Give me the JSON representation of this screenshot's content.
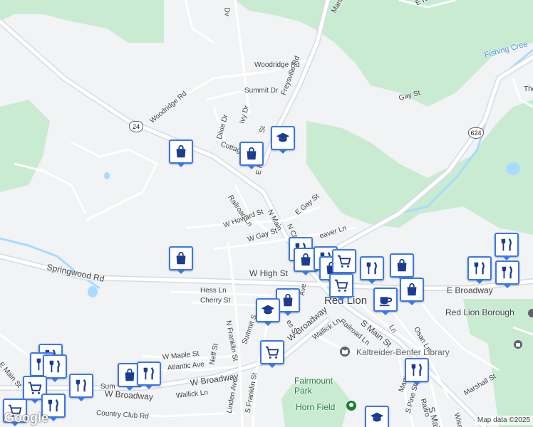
{
  "map": {
    "attribution": "Map data ©2025",
    "logo": "Google",
    "colors": {
      "land": "#f1f3f4",
      "park": "#c8ebd2",
      "water": "#aadaff",
      "major_road": "#d6dbe0",
      "road": "#ffffff",
      "pin": "#3b78e7",
      "pin_icon": "#1a3d8f"
    },
    "shields": {
      "route24": "24",
      "route624": "624"
    },
    "labels": {
      "manor": "Manor",
      "woodridge_rd_top": "Woodridge Rd",
      "freysville_rd": "Freysville Rd",
      "woodridge_rd": "Woodridge Rd",
      "summit_dr": "Summit Dr",
      "dixie_dr": "Dixie Dr",
      "ivy_dr": "Ivy Dr",
      "cottage": "Cottag",
      "e_pt_st": "E P",
      "st_frag": "St",
      "railroad_ln_n": "Railroad Ln",
      "n_main": "N Main",
      "n_chu": "N Chu",
      "e_gay_st": "E Gay St",
      "w_howard_st": "W Howard St",
      "w_gay_st": "W Gay St",
      "weaver_ln": "eaver Ln",
      "springwood_rd": "Springwood Rd",
      "w_high_st": "W High St",
      "hess_ln": "Hess Ln",
      "cherry_st": "Cherry St",
      "n_franklin_st": "N Franklin St",
      "ave_frag": "Ave",
      "red_lion": "Red Lion",
      "railroad_ln": "Railroad Ln",
      "s_main_st": "S Main St",
      "e_broadway": "E Broadway",
      "red_lion_borough": "Red Lion Borough",
      "osan_ln": "Osan Ln",
      "ln_frag": "Ln",
      "w_broadway": "W Broadway",
      "wallick_ln_e": "Wallick Ln",
      "summit_s": "Summit S",
      "es_st": "es St",
      "library": "Kaltreider-Benfer Library",
      "w_maple_st": "W Maple St",
      "atlantic_ave": "Atlantic Ave",
      "neff_st": "Neff St",
      "e_main_st": "E Main St",
      "sum": "Sum",
      "w_broadway_w": "W Broadway",
      "w_broadway_mid": "W Broadway",
      "wallick_ln": "Wallick Ln",
      "fairmount_park": "Fairmount\nPark",
      "horn_field": "Horn Field",
      "country_club_rd": "Country Club Rd",
      "linden_ave": "Linden Ave",
      "s_franklin_st": "S Franklin St",
      "martin": "Martin",
      "s_pine_st": "S Pine St",
      "railro": "Railro",
      "s_main_st_s": "S Main St",
      "wise": "Wise",
      "marshall_st": "Marshall St",
      "gay_st": "Gay St",
      "fishing_creek": "Fishing Cree",
      "th": "The",
      "dv": "Dv",
      "e_r": "E R",
      "mill": "Mill"
    }
  }
}
